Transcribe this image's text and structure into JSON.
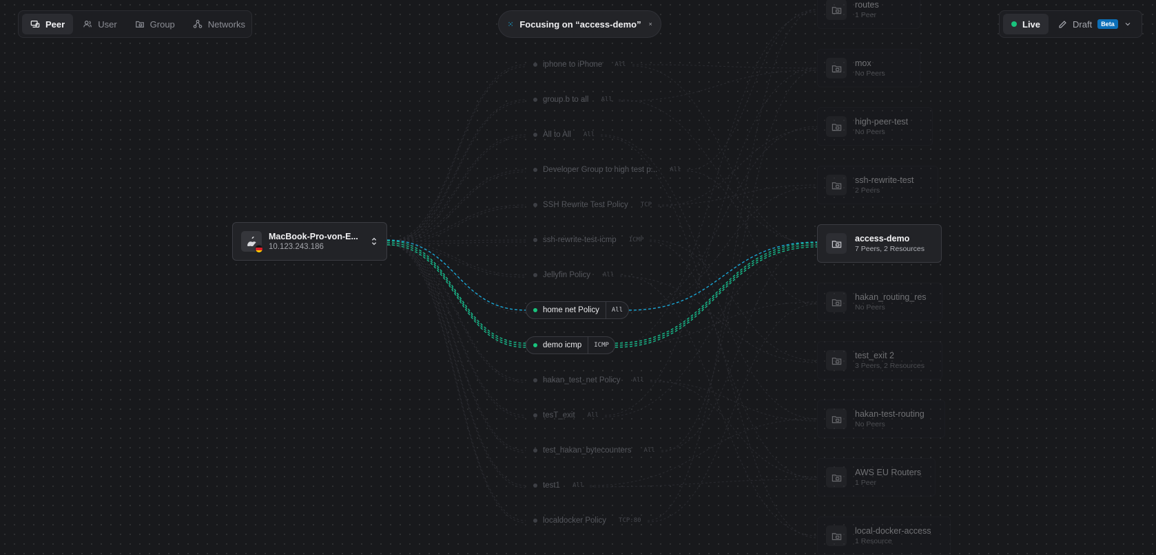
{
  "view_switcher": {
    "items": [
      {
        "label": "Peer",
        "icon": "peer-icon",
        "active": true
      },
      {
        "label": "User",
        "icon": "user-icon",
        "active": false
      },
      {
        "label": "Group",
        "icon": "group-icon",
        "active": false
      },
      {
        "label": "Networks",
        "icon": "networks-icon",
        "active": false
      }
    ]
  },
  "focus": {
    "label": "Focusing on “access-demo”",
    "icon": "focus-icon",
    "close_icon": "close-icon"
  },
  "mode": {
    "live_label": "Live",
    "draft_label": "Draft",
    "beta_badge": "Beta",
    "live_color": "#19c37d",
    "beta_color": "#0c6fb8"
  },
  "peer": {
    "name": "MacBook-Pro-von-E...",
    "ip": "10.123.243.186",
    "os_icon": "apple-icon",
    "flag": "germany-flag-icon"
  },
  "policies": [
    {
      "name": "iphone to iPhone",
      "tag": "All",
      "active": false
    },
    {
      "name": "group b to all",
      "tag": "All",
      "active": false
    },
    {
      "name": "All to All",
      "tag": "All",
      "active": false
    },
    {
      "name": "Developer Group to high test p...",
      "tag": "All",
      "active": false
    },
    {
      "name": "SSH Rewrite Test Policy",
      "tag": "TCP",
      "active": false
    },
    {
      "name": "ssh-rewrite-test-icmp",
      "tag": "ICMP",
      "active": false
    },
    {
      "name": "Jellyfin Policy",
      "tag": "All",
      "active": false
    },
    {
      "name": "home net Policy",
      "tag": "All",
      "active": true
    },
    {
      "name": "demo icmp",
      "tag": "ICMP",
      "active": true
    },
    {
      "name": "hakan_test_net Policy",
      "tag": "All",
      "active": false
    },
    {
      "name": "tesT_exit",
      "tag": "All",
      "active": false
    },
    {
      "name": "test_hakan_bytecounters",
      "tag": "All",
      "active": false
    },
    {
      "name": "test1",
      "tag": "All",
      "active": false
    },
    {
      "name": "localdocker Policy",
      "tag": "TCP:80",
      "active": false
    }
  ],
  "groups": [
    {
      "name": "routes",
      "sub": "1 Peer",
      "active": false
    },
    {
      "name": "mox",
      "sub": "No Peers",
      "active": false
    },
    {
      "name": "high-peer-test",
      "sub": "No Peers",
      "active": false
    },
    {
      "name": "ssh-rewrite-test",
      "sub": "2 Peers",
      "active": false
    },
    {
      "name": "access-demo",
      "sub": "7 Peers, 2 Resources",
      "active": true
    },
    {
      "name": "hakan_routing_res",
      "sub": "No Peers",
      "active": false
    },
    {
      "name": "test_exit 2",
      "sub": "3 Peers, 2 Resources",
      "active": false
    },
    {
      "name": "hakan-test-routing",
      "sub": "No Peers",
      "active": false
    },
    {
      "name": "AWS EU Routers",
      "sub": "1 Peer",
      "active": false
    },
    {
      "name": "local-docker-access",
      "sub": "1 Resource",
      "active": false
    }
  ],
  "colors": {
    "edge_blue": "#1aa7d6",
    "edge_green": "#17b98a"
  }
}
